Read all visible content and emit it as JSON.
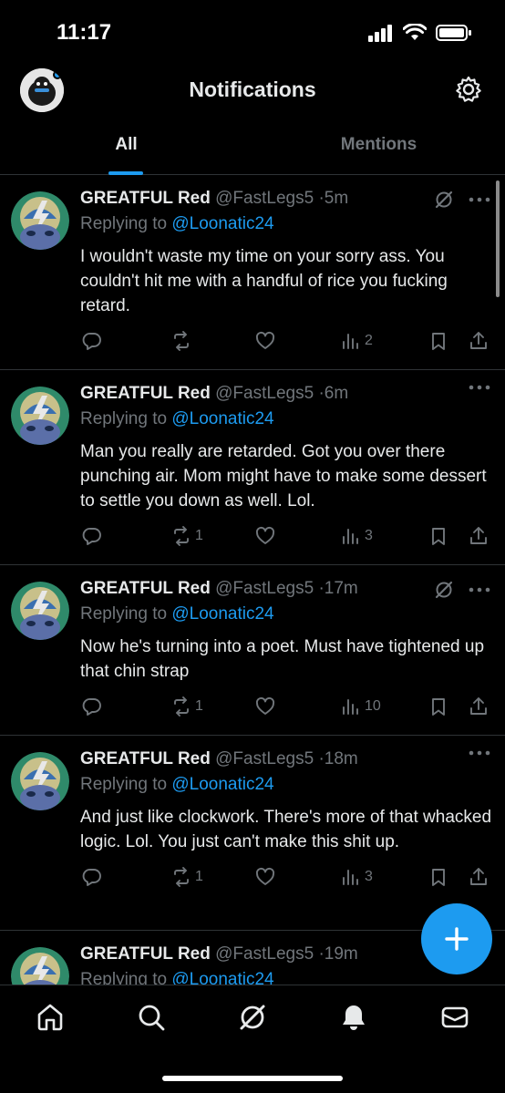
{
  "status_bar": {
    "time": "11:17"
  },
  "header": {
    "title": "Notifications"
  },
  "tabs": [
    {
      "label": "All",
      "active": true
    },
    {
      "label": "Mentions",
      "active": false
    }
  ],
  "tweets": [
    {
      "name": "GREATFUL Red",
      "handle": "@FastLegs5",
      "time": "5m",
      "replying_label": "Replying to",
      "replying_to": "@Loonatic24",
      "text": "I wouldn't waste my time on your sorry ass. You couldn't hit me with a handful of rice you fucking retard.",
      "retweets": "",
      "views": "2",
      "grok_icon": true
    },
    {
      "name": "GREATFUL Red",
      "handle": "@FastLegs5",
      "time": "6m",
      "replying_label": "Replying to",
      "replying_to": "@Loonatic24",
      "text": "Man you really are retarded. Got you over there punching air. Mom might have to make some dessert to settle you down as well. Lol.",
      "retweets": "1",
      "views": "3",
      "grok_icon": false
    },
    {
      "name": "GREATFUL Red",
      "handle": "@FastLegs5",
      "time": "17m",
      "replying_label": "Replying to",
      "replying_to": "@Loonatic24",
      "text": "Now he's turning into a poet. Must have tightened up that chin strap",
      "retweets": "1",
      "views": "10",
      "grok_icon": true
    },
    {
      "name": "GREATFUL Red",
      "handle": "@FastLegs5",
      "time": "18m",
      "replying_label": "Replying to",
      "replying_to": "@Loonatic24",
      "text": "And just like clockwork. There's more of that whacked logic. Lol. You just can't make this shit up.",
      "retweets": "1",
      "views": "3",
      "grok_icon": false
    },
    {
      "name": "GREATFUL Red",
      "handle": "@FastLegs5",
      "time": "19m",
      "replying_label": "Replying to",
      "replying_to": "@Loonatic24",
      "text": "",
      "retweets": "",
      "views": "",
      "grok_icon": false
    }
  ],
  "colors": {
    "accent": "#1d9bf0",
    "muted": "#71767b",
    "background": "#000000",
    "text": "#e7e9ea"
  },
  "icons": {
    "nav": [
      "home-icon",
      "search-icon",
      "grok-icon",
      "bell-icon",
      "mail-icon"
    ],
    "actions": [
      "reply-icon",
      "retweet-icon",
      "like-icon",
      "views-icon",
      "bookmark-icon",
      "share-icon"
    ]
  }
}
